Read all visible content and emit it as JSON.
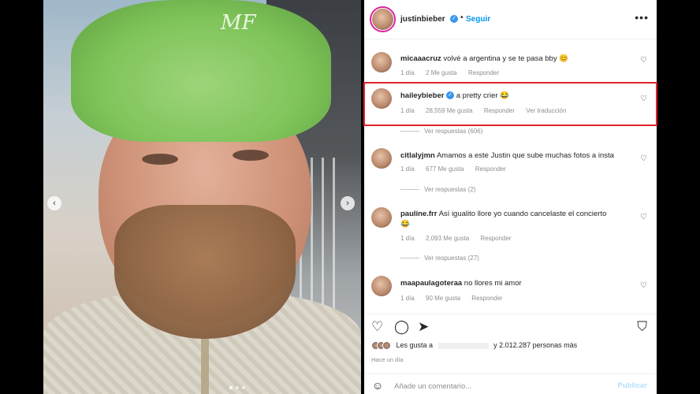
{
  "post": {
    "username": "justinbieber",
    "follow_label": "Seguir",
    "separator": "•",
    "more_icon": "more-horizontal-icon",
    "hat_logo": "MF"
  },
  "comments": [
    {
      "user": "micaaacruz",
      "text": "volvé a argentina y se te pasa bby 😊",
      "time": "1 día",
      "likes": "2 Me gusta",
      "reply": "Responder"
    },
    {
      "user": "haileybieber",
      "text": "a pretty crier 😂",
      "time": "1 día",
      "likes": "28,559 Me gusta",
      "reply": "Responder",
      "translate": "Ver traducción",
      "replies": "Ver respuestas (606)"
    },
    {
      "user": "citlalyjmn",
      "text": "Amamos a este Justin que sube muchas fotos a insta",
      "time": "1 día",
      "likes": "677 Me gusta",
      "reply": "Responder",
      "replies": "Ver respuestas (2)"
    },
    {
      "user": "pauline.frr",
      "text": "Así igualito llore yo cuando cancelaste el concierto",
      "text2": "😂",
      "time": "1 día",
      "likes": "2,093 Me gusta",
      "reply": "Responder",
      "replies": "Ver respuestas (27)"
    },
    {
      "user": "maapaulagoteraa",
      "text": "no llores mi amor",
      "time": "1 día",
      "likes": "90 Me gusta",
      "reply": "Responder"
    }
  ],
  "likes_summary": {
    "prefix": "Les gusta a",
    "suffix": "y 2.012.287 personas más"
  },
  "time_ago": "Hace un día",
  "add_comment": {
    "placeholder": "Añade un comentario...",
    "publish": "Publicar"
  },
  "colors": {
    "accent": "#0095f6",
    "highlight": "#e0212b"
  }
}
